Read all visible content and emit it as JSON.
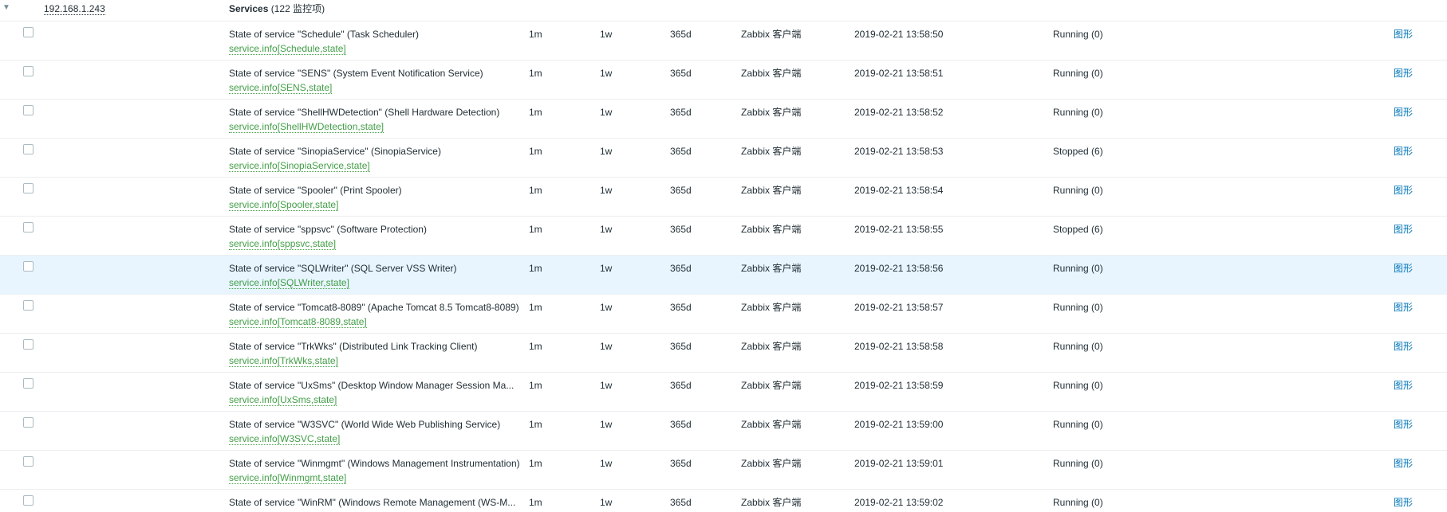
{
  "group": {
    "host": "192.168.1.243",
    "app_name": "Services",
    "app_count": "(122 监控项)"
  },
  "colors": {
    "key_green": "#429e47",
    "link_blue": "#0275b8",
    "hover_row": "#e8f5ff"
  },
  "items": [
    {
      "name": "State of service \"Schedule\" (Task Scheduler)",
      "key": "service.info[Schedule,state]",
      "interval": "1m",
      "history": "1w",
      "trends": "365d",
      "type": "Zabbix 客户端",
      "last_check": "2019-02-21 13:58:50",
      "last_value": "Running (0)",
      "graph": "图形"
    },
    {
      "name": "State of service \"SENS\" (System Event Notification Service)",
      "key": "service.info[SENS,state]",
      "interval": "1m",
      "history": "1w",
      "trends": "365d",
      "type": "Zabbix 客户端",
      "last_check": "2019-02-21 13:58:51",
      "last_value": "Running (0)",
      "graph": "图形"
    },
    {
      "name": "State of service \"ShellHWDetection\" (Shell Hardware Detection)",
      "key": "service.info[ShellHWDetection,state]",
      "interval": "1m",
      "history": "1w",
      "trends": "365d",
      "type": "Zabbix 客户端",
      "last_check": "2019-02-21 13:58:52",
      "last_value": "Running (0)",
      "graph": "图形"
    },
    {
      "name": "State of service \"SinopiaService\" (SinopiaService)",
      "key": "service.info[SinopiaService,state]",
      "interval": "1m",
      "history": "1w",
      "trends": "365d",
      "type": "Zabbix 客户端",
      "last_check": "2019-02-21 13:58:53",
      "last_value": "Stopped (6)",
      "graph": "图形"
    },
    {
      "name": "State of service \"Spooler\" (Print Spooler)",
      "key": "service.info[Spooler,state]",
      "interval": "1m",
      "history": "1w",
      "trends": "365d",
      "type": "Zabbix 客户端",
      "last_check": "2019-02-21 13:58:54",
      "last_value": "Running (0)",
      "graph": "图形"
    },
    {
      "name": "State of service \"sppsvc\" (Software Protection)",
      "key": "service.info[sppsvc,state]",
      "interval": "1m",
      "history": "1w",
      "trends": "365d",
      "type": "Zabbix 客户端",
      "last_check": "2019-02-21 13:58:55",
      "last_value": "Stopped (6)",
      "graph": "图形"
    },
    {
      "name": "State of service \"SQLWriter\" (SQL Server VSS Writer)",
      "key": "service.info[SQLWriter,state]",
      "interval": "1m",
      "history": "1w",
      "trends": "365d",
      "type": "Zabbix 客户端",
      "last_check": "2019-02-21 13:58:56",
      "last_value": "Running (0)",
      "graph": "图形",
      "hover": true
    },
    {
      "name": "State of service \"Tomcat8-8089\" (Apache Tomcat 8.5 Tomcat8-8089)",
      "key": "service.info[Tomcat8-8089,state]",
      "interval": "1m",
      "history": "1w",
      "trends": "365d",
      "type": "Zabbix 客户端",
      "last_check": "2019-02-21 13:58:57",
      "last_value": "Running (0)",
      "graph": "图形"
    },
    {
      "name": "State of service \"TrkWks\" (Distributed Link Tracking Client)",
      "key": "service.info[TrkWks,state]",
      "interval": "1m",
      "history": "1w",
      "trends": "365d",
      "type": "Zabbix 客户端",
      "last_check": "2019-02-21 13:58:58",
      "last_value": "Running (0)",
      "graph": "图形"
    },
    {
      "name": "State of service \"UxSms\" (Desktop Window Manager Session Ma...",
      "key": "service.info[UxSms,state]",
      "interval": "1m",
      "history": "1w",
      "trends": "365d",
      "type": "Zabbix 客户端",
      "last_check": "2019-02-21 13:58:59",
      "last_value": "Running (0)",
      "graph": "图形"
    },
    {
      "name": "State of service \"W3SVC\" (World Wide Web Publishing Service)",
      "key": "service.info[W3SVC,state]",
      "interval": "1m",
      "history": "1w",
      "trends": "365d",
      "type": "Zabbix 客户端",
      "last_check": "2019-02-21 13:59:00",
      "last_value": "Running (0)",
      "graph": "图形"
    },
    {
      "name": "State of service \"Winmgmt\" (Windows Management Instrumentation)",
      "key": "service.info[Winmgmt,state]",
      "interval": "1m",
      "history": "1w",
      "trends": "365d",
      "type": "Zabbix 客户端",
      "last_check": "2019-02-21 13:59:01",
      "last_value": "Running (0)",
      "graph": "图形"
    },
    {
      "name": "State of service \"WinRM\" (Windows Remote Management (WS-M...",
      "key": "",
      "interval": "1m",
      "history": "1w",
      "trends": "365d",
      "type": "Zabbix 客户端",
      "last_check": "2019-02-21 13:59:02",
      "last_value": "Running (0)",
      "graph": "图形"
    }
  ]
}
